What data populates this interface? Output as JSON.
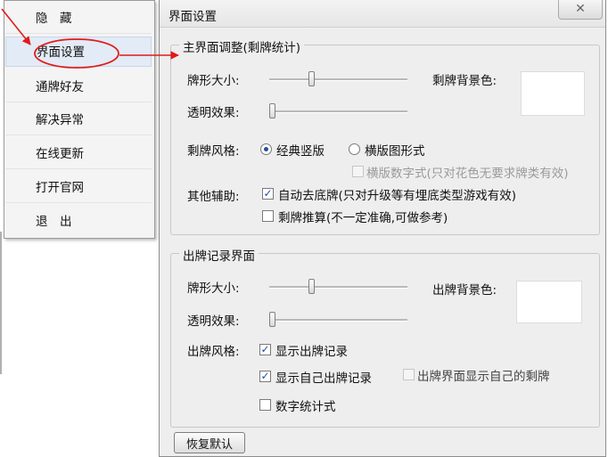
{
  "menu": {
    "items": [
      {
        "label": "隐　藏"
      },
      {
        "label": "界面设置"
      },
      {
        "label": "通牌好友"
      },
      {
        "label": "解决异常"
      },
      {
        "label": "在线更新"
      },
      {
        "label": "打开官网"
      },
      {
        "label": "退　出"
      }
    ]
  },
  "window": {
    "title": "界面设置",
    "close_symbol": "✕",
    "main_group": {
      "title": "主界面调整(剩牌统计)",
      "card_size_label": "牌形大小:",
      "card_size_value": 0.3,
      "opacity_label": "透明效果:",
      "opacity_value": 0.0,
      "bg_color_label": "剩牌背景色:",
      "bg_color": "#ffffff",
      "style_label": "剩牌风格:",
      "style_options": [
        "经典竖版",
        "横版图形式"
      ],
      "style_selected": "经典竖版",
      "horizontal_number_label": "横版数字式(只对花色无要求牌类有效)",
      "other_label": "其他辅助:",
      "auto_bottom_label": "自动去底牌(只对升级等有埋底类型游戏有效)",
      "auto_bottom_checked": true,
      "calc_label": "剩牌推算(不一定准确,可做参考)",
      "calc_checked": false
    },
    "record_group": {
      "title": "出牌记录界面",
      "card_size_label": "牌形大小:",
      "card_size_value": 0.3,
      "opacity_label": "透明效果:",
      "opacity_value": 0.0,
      "bg_color_label": "出牌背景色:",
      "bg_color": "#ffffff",
      "style_label": "出牌风格:",
      "show_record_label": "显示出牌记录",
      "show_record_checked": true,
      "show_own_label": "显示自己出牌记录",
      "show_own_checked": true,
      "show_remaining_label": "出牌界面显示自己的剩牌",
      "show_remaining_checked": false,
      "number_stat_label": "数字统计式",
      "number_stat_checked": false
    },
    "restore_label": "恢复默认"
  },
  "colors": {
    "annotation": "#e01b1b",
    "selected": "#1f4f9e"
  }
}
